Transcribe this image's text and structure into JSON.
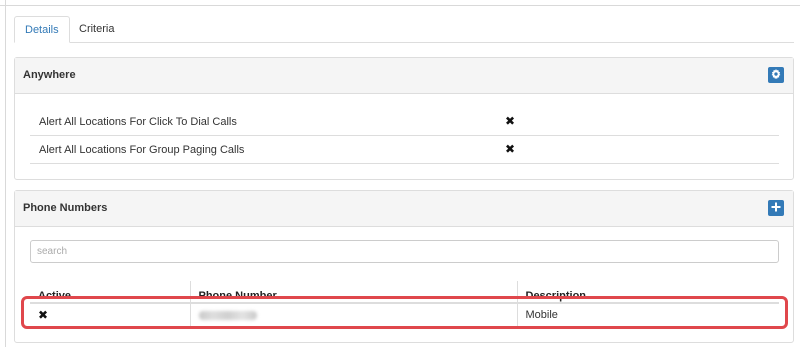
{
  "tabs": [
    {
      "label": "Details",
      "active": true
    },
    {
      "label": "Criteria",
      "active": false
    }
  ],
  "anywhere": {
    "title": "Anywhere",
    "settings_icon": "gear-icon",
    "rows": [
      {
        "label": "Alert All Locations For Click To Dial Calls",
        "value_icon": "x-mark-icon",
        "value": "✖"
      },
      {
        "label": "Alert All Locations For Group Paging Calls",
        "value_icon": "x-mark-icon",
        "value": "✖"
      }
    ]
  },
  "phone_numbers": {
    "title": "Phone Numbers",
    "add_icon": "plus-icon",
    "search_placeholder": "search",
    "columns": [
      "Active",
      "Phone Number",
      "Description"
    ],
    "rows": [
      {
        "active": "✖",
        "active_icon": "x-mark-icon",
        "phone_number_redacted": true,
        "description": "Mobile"
      }
    ]
  },
  "colors": {
    "accent": "#337ab7",
    "highlight": "#e0474c"
  }
}
